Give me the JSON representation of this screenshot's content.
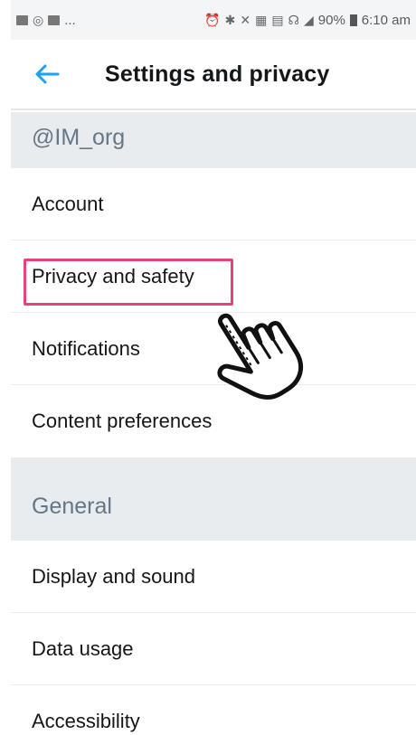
{
  "status_bar": {
    "left_icons": [
      "image-icon",
      "whatsapp-icon",
      "mail-icon"
    ],
    "ellipsis": "...",
    "battery": "90%",
    "time": "6:10 am"
  },
  "header": {
    "title": "Settings and privacy",
    "back_icon": "arrow-left-icon",
    "accent_color": "#1da1f2"
  },
  "sections": [
    {
      "header": "@IM_org",
      "items": [
        {
          "label": "Account"
        },
        {
          "label": "Privacy and safety",
          "highlighted": true
        },
        {
          "label": "Notifications"
        },
        {
          "label": "Content preferences"
        }
      ]
    },
    {
      "header": "General",
      "items": [
        {
          "label": "Display and sound"
        },
        {
          "label": "Data usage"
        },
        {
          "label": "Accessibility"
        }
      ]
    }
  ],
  "colors": {
    "highlight": "#e8447a",
    "section_bg": "#e8ecef",
    "section_text": "#657786"
  },
  "annotation_icon": "hand-pointer-icon"
}
